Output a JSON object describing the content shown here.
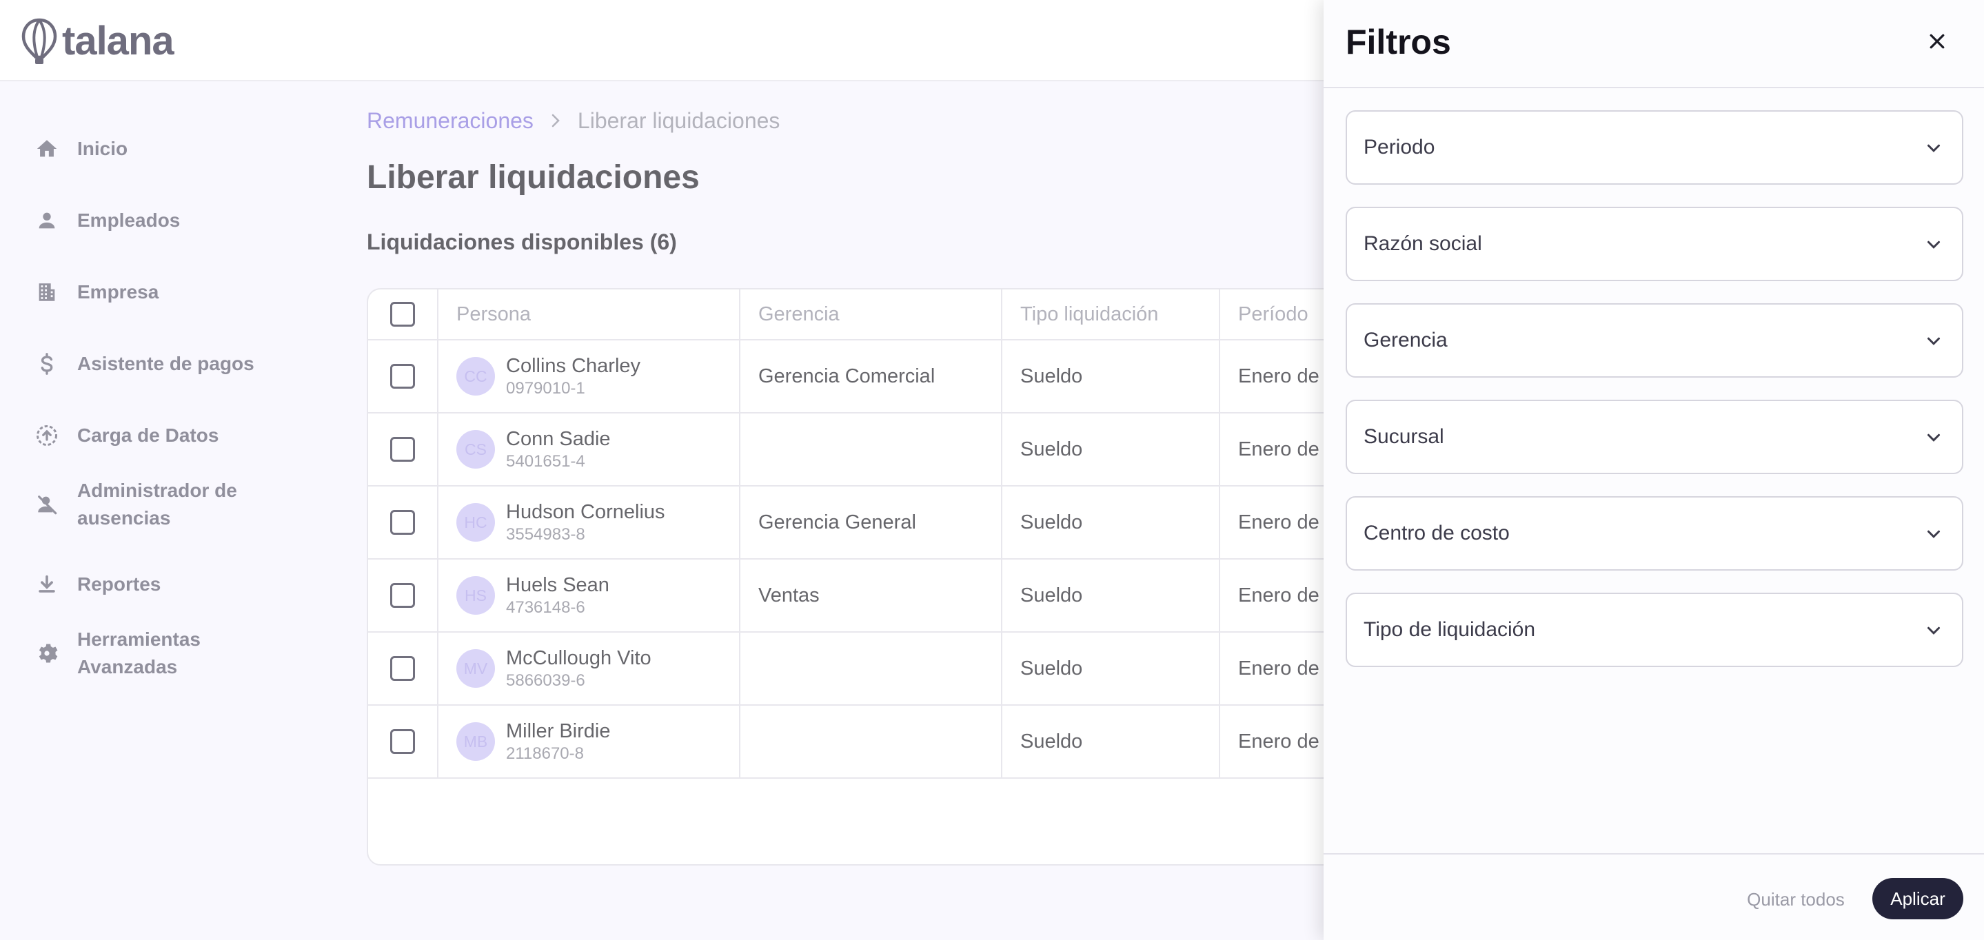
{
  "app": {
    "logo_text": "talana"
  },
  "sidebar": {
    "items": [
      {
        "label": "Inicio",
        "icon": "home-icon"
      },
      {
        "label": "Empleados",
        "icon": "person-icon"
      },
      {
        "label": "Empresa",
        "icon": "building-icon"
      },
      {
        "label": "Asistente de pagos",
        "icon": "dollar-icon"
      },
      {
        "label": "Carga de Datos",
        "icon": "upload-icon"
      },
      {
        "label": "Administrador de ausencias",
        "icon": "person-off-icon"
      },
      {
        "label": "Reportes",
        "icon": "download-icon"
      },
      {
        "label": "Herramientas Avanzadas",
        "icon": "gear-icon"
      }
    ]
  },
  "breadcrumb": {
    "parent": "Remuneraciones",
    "current": "Liberar liquidaciones"
  },
  "page": {
    "title": "Liberar liquidaciones",
    "subtitle": "Liquidaciones disponibles (6)"
  },
  "table": {
    "columns": [
      "Persona",
      "Gerencia",
      "Tipo liquidación",
      "Período"
    ],
    "rows": [
      {
        "initials": "CC",
        "name": "Collins Charley",
        "id": "0979010-1",
        "gerencia": "Gerencia Comercial",
        "tipo": "Sueldo",
        "periodo": "Enero de"
      },
      {
        "initials": "CS",
        "name": "Conn Sadie",
        "id": "5401651-4",
        "gerencia": "",
        "tipo": "Sueldo",
        "periodo": "Enero de"
      },
      {
        "initials": "HC",
        "name": "Hudson Cornelius",
        "id": "3554983-8",
        "gerencia": "Gerencia General",
        "tipo": "Sueldo",
        "periodo": "Enero de"
      },
      {
        "initials": "HS",
        "name": "Huels Sean",
        "id": "4736148-6",
        "gerencia": "Ventas",
        "tipo": "Sueldo",
        "periodo": "Enero de"
      },
      {
        "initials": "MV",
        "name": "McCullough Vito",
        "id": "5866039-6",
        "gerencia": "",
        "tipo": "Sueldo",
        "periodo": "Enero de"
      },
      {
        "initials": "MB",
        "name": "Miller Birdie",
        "id": "2118670-8",
        "gerencia": "",
        "tipo": "Sueldo",
        "periodo": "Enero de"
      }
    ]
  },
  "filters": {
    "title": "Filtros",
    "fields": [
      {
        "label": "Periodo"
      },
      {
        "label": "Razón social"
      },
      {
        "label": "Gerencia"
      },
      {
        "label": "Sucursal"
      },
      {
        "label": "Centro de costo"
      },
      {
        "label": "Tipo de liquidación"
      }
    ],
    "clear_label": "Quitar todos",
    "apply_label": "Aplicar"
  },
  "colors": {
    "accent": "#7b6cd9",
    "avatar_bg": "#c7bff5",
    "primary_button": "#23233a",
    "page_bg": "#f6f5fd"
  }
}
